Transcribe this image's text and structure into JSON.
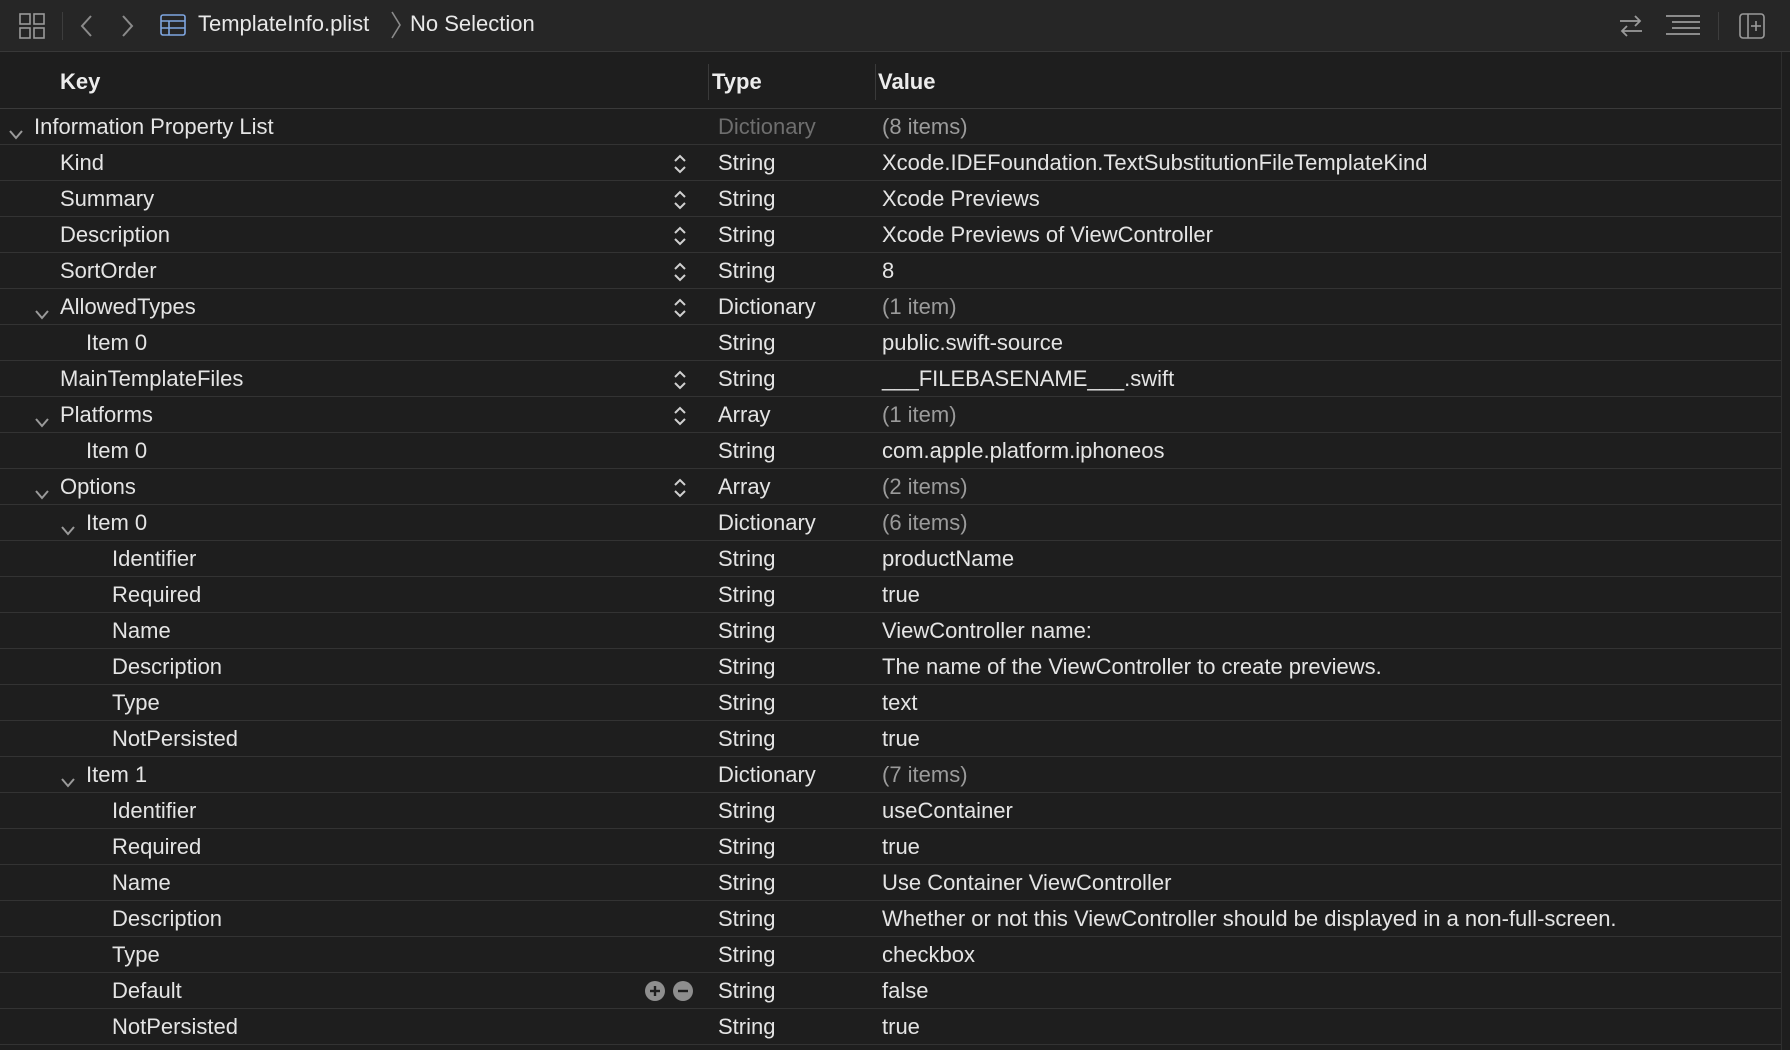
{
  "toolbar": {
    "file_name": "TemplateInfo.plist",
    "selection": "No Selection",
    "icons": [
      "grid-icon",
      "back-icon",
      "forward-icon",
      "table-icon",
      "swap-icon",
      "lines-icon",
      "add-editor-icon"
    ]
  },
  "columns": {
    "key": "Key",
    "type": "Type",
    "value": "Value"
  },
  "colors": {
    "background": "#1e1e1e",
    "text": "#e4e4e4",
    "dim_text": "#9b9b9b",
    "divider": "#333333"
  },
  "rows": [
    {
      "key": "Information Property List",
      "type": "Dictionary",
      "value": "(8 items)",
      "depth": 0,
      "expanded": true,
      "dim_type": true,
      "dim_value": true,
      "stepper": false
    },
    {
      "key": "Kind",
      "type": "String",
      "value": "Xcode.IDEFoundation.TextSubstitutionFileTemplateKind",
      "depth": 1,
      "stepper": true
    },
    {
      "key": "Summary",
      "type": "String",
      "value": "Xcode Previews",
      "depth": 1,
      "stepper": true
    },
    {
      "key": "Description",
      "type": "String",
      "value": "Xcode Previews of ViewController",
      "depth": 1,
      "stepper": true
    },
    {
      "key": "SortOrder",
      "type": "String",
      "value": "8",
      "depth": 1,
      "stepper": true
    },
    {
      "key": "AllowedTypes",
      "type": "Dictionary",
      "value": "(1 item)",
      "depth": 1,
      "expanded": true,
      "dim_value": true,
      "stepper": true
    },
    {
      "key": "Item 0",
      "type": "String",
      "value": "public.swift-source",
      "depth": 2
    },
    {
      "key": "MainTemplateFiles",
      "type": "String",
      "value": "___FILEBASENAME___.swift",
      "depth": 1,
      "stepper": true
    },
    {
      "key": "Platforms",
      "type": "Array",
      "value": "(1 item)",
      "depth": 1,
      "expanded": true,
      "dim_value": true,
      "stepper": true
    },
    {
      "key": "Item 0",
      "type": "String",
      "value": "com.apple.platform.iphoneos",
      "depth": 2
    },
    {
      "key": "Options",
      "type": "Array",
      "value": "(2 items)",
      "depth": 1,
      "expanded": true,
      "dim_value": true,
      "stepper": true
    },
    {
      "key": "Item 0",
      "type": "Dictionary",
      "value": "(6 items)",
      "depth": 2,
      "expanded": true,
      "dim_value": true
    },
    {
      "key": "Identifier",
      "type": "String",
      "value": "productName",
      "depth": 3
    },
    {
      "key": "Required",
      "type": "String",
      "value": "true",
      "depth": 3
    },
    {
      "key": "Name",
      "type": "String",
      "value": "ViewController name:",
      "depth": 3
    },
    {
      "key": "Description",
      "type": "String",
      "value": "The name of the ViewController to create previews.",
      "depth": 3
    },
    {
      "key": "Type",
      "type": "String",
      "value": "text",
      "depth": 3
    },
    {
      "key": "NotPersisted",
      "type": "String",
      "value": "true",
      "depth": 3
    },
    {
      "key": "Item 1",
      "type": "Dictionary",
      "value": "(7 items)",
      "depth": 2,
      "expanded": true,
      "dim_value": true
    },
    {
      "key": "Identifier",
      "type": "String",
      "value": "useContainer",
      "depth": 3
    },
    {
      "key": "Required",
      "type": "String",
      "value": "true",
      "depth": 3
    },
    {
      "key": "Name",
      "type": "String",
      "value": "Use Container ViewController",
      "depth": 3
    },
    {
      "key": "Description",
      "type": "String",
      "value": "Whether or not this ViewController should be displayed in a non-full-screen.",
      "depth": 3
    },
    {
      "key": "Type",
      "type": "String",
      "value": "checkbox",
      "depth": 3
    },
    {
      "key": "Default",
      "type": "String",
      "value": "false",
      "depth": 3,
      "plus_minus": true
    },
    {
      "key": "NotPersisted",
      "type": "String",
      "value": "true",
      "depth": 3
    }
  ]
}
